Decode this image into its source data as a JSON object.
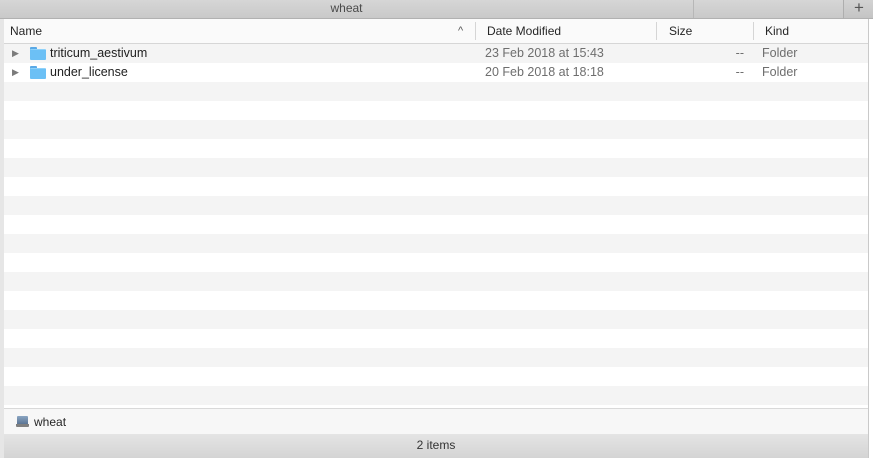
{
  "window": {
    "title": "wheat",
    "new_tab_symbol": "+"
  },
  "columns": {
    "name": "Name",
    "date_modified": "Date Modified",
    "size": "Size",
    "kind": "Kind",
    "sort_indicator": "^"
  },
  "rows": [
    {
      "name": "triticum_aestivum",
      "date_modified": "23 Feb 2018 at 15:43",
      "size": "--",
      "kind": "Folder",
      "icon": "folder-icon",
      "expanded": false
    },
    {
      "name": "under_license",
      "date_modified": "20 Feb 2018 at 18:18",
      "size": "--",
      "kind": "Folder",
      "icon": "folder-icon",
      "expanded": false
    }
  ],
  "path_bar": {
    "label": "wheat",
    "icon": "hard-drive-icon"
  },
  "status": {
    "items_count": "2 items"
  },
  "colors": {
    "folder": "#6cc0f5",
    "stripe": "#f4f4f4",
    "header": "#fafafa"
  }
}
